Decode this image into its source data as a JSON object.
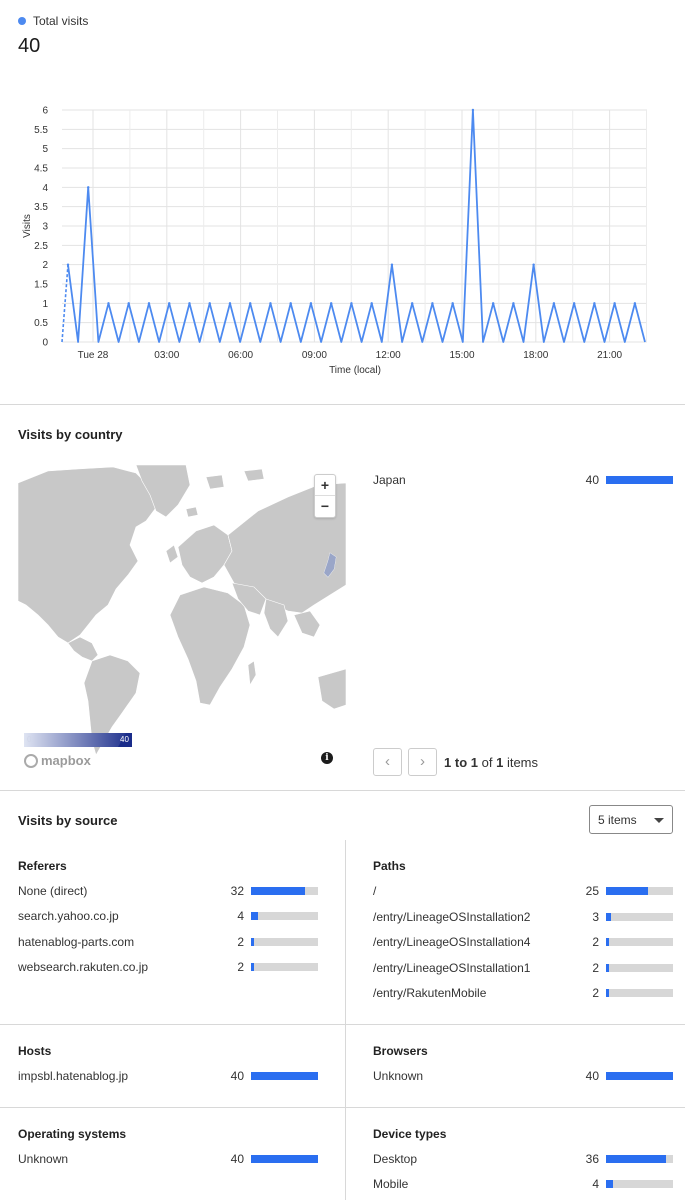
{
  "summary": {
    "legend_label": "Total visits",
    "total": "40",
    "legend_color": "#4d8af0"
  },
  "chart_data": {
    "type": "line",
    "ylabel": "Visits",
    "xlabel": "Time (local)",
    "ylim": [
      0,
      6
    ],
    "y_ticks": [
      "0",
      "0.5",
      "1",
      "1.5",
      "2",
      "2.5",
      "3",
      "3.5",
      "4",
      "4.5",
      "5",
      "5.5",
      "6"
    ],
    "x_tick_labels": [
      "Tue 28",
      "03:00",
      "06:00",
      "09:00",
      "12:00",
      "15:00",
      "18:00",
      "21:00"
    ],
    "grid": true,
    "series": [
      {
        "color": "#4d8af0",
        "values": [
          2,
          0,
          4,
          0,
          1,
          0,
          1,
          0,
          1,
          0,
          1,
          0,
          1,
          0,
          1,
          0,
          1,
          0,
          1,
          0,
          1,
          0,
          1,
          0,
          1,
          0,
          1,
          0,
          1,
          0,
          1,
          0,
          2,
          0,
          1,
          0,
          1,
          0,
          1,
          0,
          6,
          0,
          1,
          0,
          1,
          0,
          2,
          0,
          1,
          0,
          1,
          0,
          1,
          0,
          1,
          0,
          1,
          0
        ]
      }
    ]
  },
  "country": {
    "title": "Visits by country",
    "rows": [
      {
        "label": "Japan",
        "value": "40",
        "fraction": 1.0
      }
    ],
    "scale_min": "0",
    "scale_max": "40",
    "zoom_in": "+",
    "zoom_out": "−",
    "map_brand": "mapbox",
    "info_glyph": "i",
    "pager": {
      "prev": "‹",
      "next": "›",
      "from": "1",
      "to_word": "to",
      "to": "1",
      "of_word": "of",
      "total": "1",
      "items_word": "items"
    }
  },
  "source": {
    "title": "Visits by source",
    "select_value": "5 items",
    "referers": {
      "title": "Referers",
      "rows": [
        {
          "label": "None (direct)",
          "value": "32",
          "fraction": 0.8
        },
        {
          "label": "search.yahoo.co.jp",
          "value": "4",
          "fraction": 0.1
        },
        {
          "label": "hatenablog-parts.com",
          "value": "2",
          "fraction": 0.05
        },
        {
          "label": "websearch.rakuten.co.jp",
          "value": "2",
          "fraction": 0.05
        }
      ]
    },
    "paths": {
      "title": "Paths",
      "rows": [
        {
          "label": "/",
          "value": "25",
          "fraction": 0.625
        },
        {
          "label": "/entry/LineageOSInstallation2",
          "value": "3",
          "fraction": 0.075
        },
        {
          "label": "/entry/LineageOSInstallation4",
          "value": "2",
          "fraction": 0.05
        },
        {
          "label": "/entry/LineageOSInstallation1",
          "value": "2",
          "fraction": 0.05
        },
        {
          "label": "/entry/RakutenMobile",
          "value": "2",
          "fraction": 0.05
        }
      ]
    },
    "hosts": {
      "title": "Hosts",
      "rows": [
        {
          "label": "impsbl.hatenablog.jp",
          "value": "40",
          "fraction": 1.0
        }
      ]
    },
    "browsers": {
      "title": "Browsers",
      "rows": [
        {
          "label": "Unknown",
          "value": "40",
          "fraction": 1.0
        }
      ]
    },
    "os": {
      "title": "Operating systems",
      "rows": [
        {
          "label": "Unknown",
          "value": "40",
          "fraction": 1.0
        }
      ]
    },
    "devices": {
      "title": "Device types",
      "rows": [
        {
          "label": "Desktop",
          "value": "36",
          "fraction": 0.9
        },
        {
          "label": "Mobile",
          "value": "4",
          "fraction": 0.1
        }
      ]
    }
  }
}
